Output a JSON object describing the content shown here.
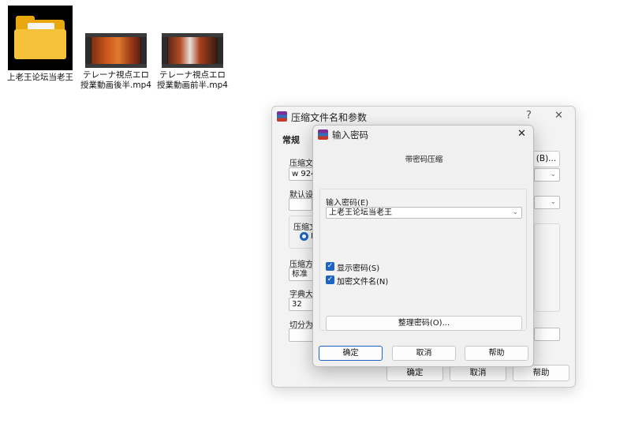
{
  "desktop": {
    "icons": [
      {
        "label": "上老王论坛当老王",
        "icon": "folder-icon"
      },
      {
        "label": "テレーナ視点エロ授業動画後半.mp4",
        "icon": "video-thumbnail"
      },
      {
        "label": "テレーナ視点エロ授業動画前半.mp4",
        "icon": "video-thumbnail"
      }
    ]
  },
  "archive_dialog": {
    "title": "压缩文件名和参数",
    "help_glyph": "?",
    "close_glyph": "✕",
    "tab_general": "常规",
    "archive_name_label": "压缩文",
    "archive_name_value": "w 924.",
    "browse_button": "(B)...",
    "default_settings_label": "默认设置",
    "format_label": "压缩文",
    "format_radio_label": "R",
    "method_label": "压缩方",
    "method_value": "标准",
    "dict_label": "字典大",
    "dict_value": "32",
    "split_label": "切分为",
    "ok_button": "确定",
    "cancel_button": "取消",
    "help_button": "帮助"
  },
  "password_dialog": {
    "title": "输入密码",
    "close_glyph": "✕",
    "heading": "带密码压缩",
    "password_label": "输入密码(E)",
    "password_value": "上老王论坛当老王",
    "show_password_label": "显示密码(S)",
    "show_password_checked": true,
    "encrypt_names_label": "加密文件名(N)",
    "encrypt_names_checked": true,
    "organize_button": "整理密码(O)...",
    "ok_button": "确定",
    "cancel_button": "取消",
    "help_button": "帮助"
  },
  "colors": {
    "accent": "#1f63c4",
    "folder": "#f7c23b"
  }
}
